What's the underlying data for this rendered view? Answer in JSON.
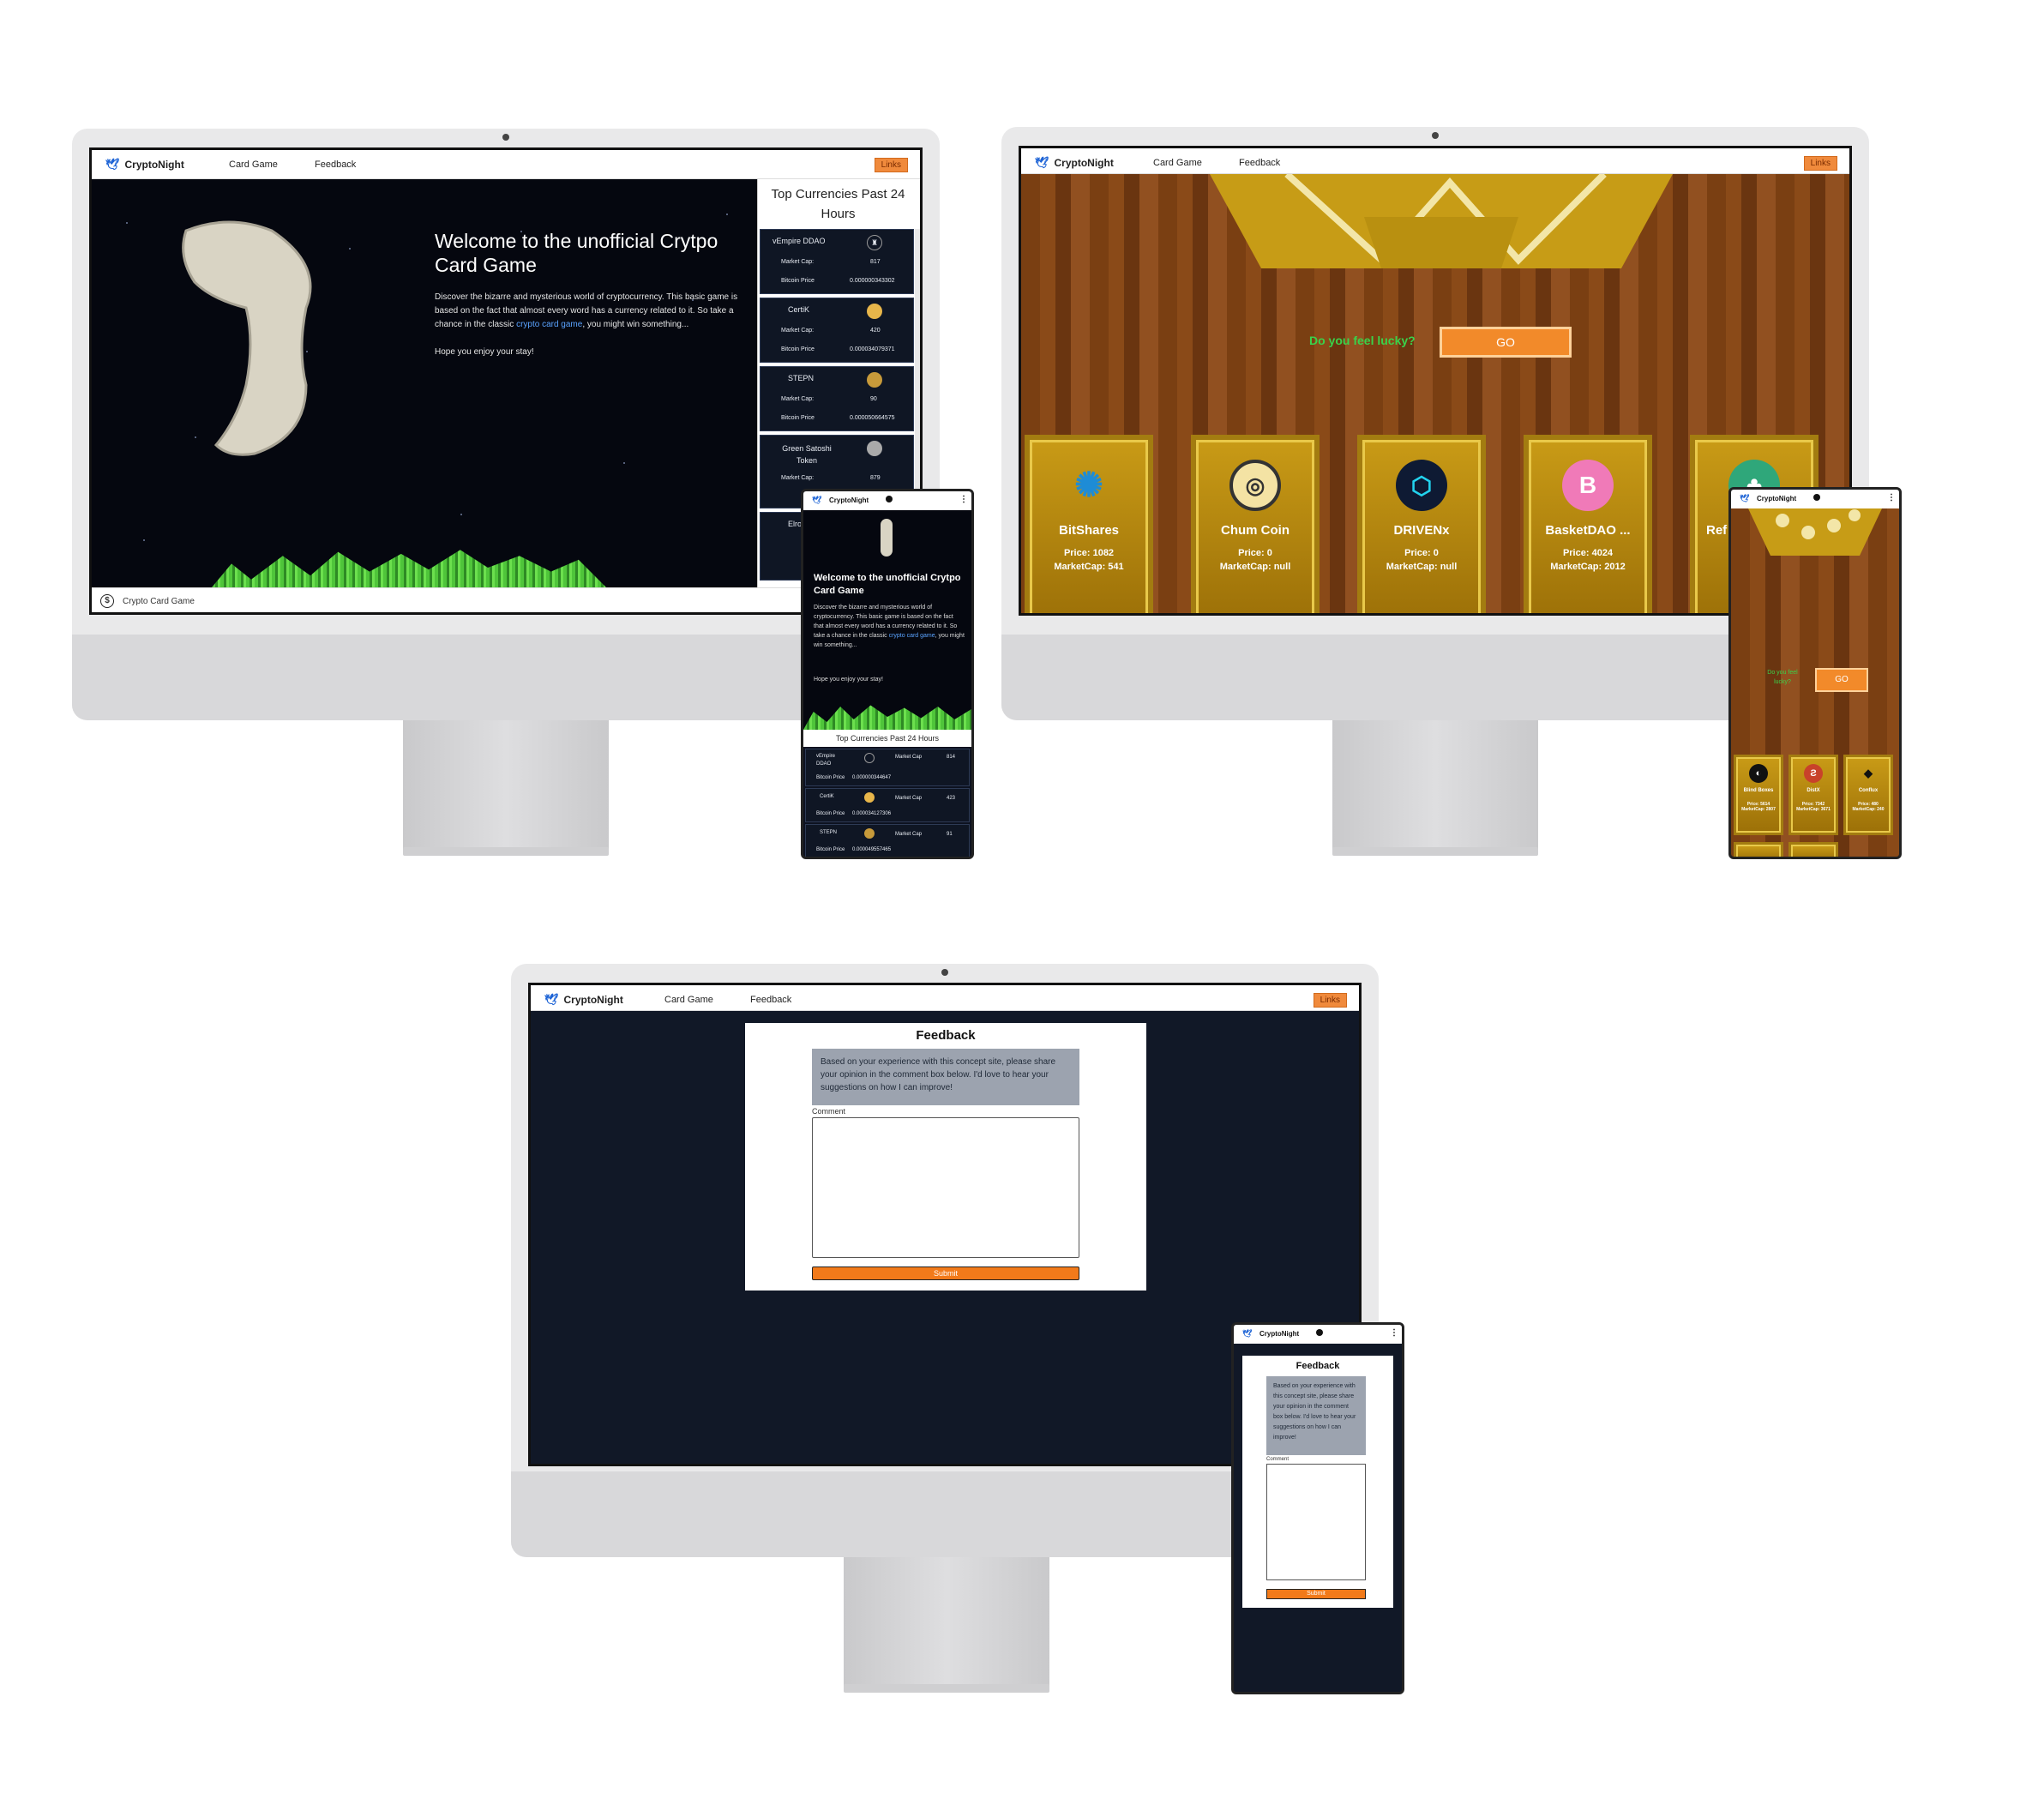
{
  "nav": {
    "brand": "CryptoNight",
    "card_game": "Card Game",
    "feedback": "Feedback",
    "links": "Links"
  },
  "home": {
    "title": "Welcome to the unofficial Crytpo Card Game",
    "para1_a": "Discover the bizarre and mysterious world of cryptocurrency. This basic game is based on the fact that almost every word has a currency related to it. So take a chance in the classic ",
    "para1_link": "crypto card game",
    "para1_b": ", you might win something...",
    "para2": "Hope you enjoy your stay!",
    "sidebar_title": "Top Currencies Past 24 Hours",
    "footer": "Crypto Card Game",
    "market_cap_label": "Market Cap:",
    "btc_price_label": "Bitcoin Price",
    "currencies": [
      {
        "name": "vEmpire DDAO",
        "market_cap": "817",
        "btc_price": "0.000000343302"
      },
      {
        "name": "CertiK",
        "market_cap": "420",
        "btc_price": "0.000034079371"
      },
      {
        "name": "STEPN",
        "market_cap": "90",
        "btc_price": "0.000050664575"
      },
      {
        "name": "Green Satoshi Token",
        "market_cap": "879",
        "btc_price": ""
      },
      {
        "name": "Elron",
        "market_cap": "",
        "btc_price": ""
      }
    ]
  },
  "home_phone": {
    "title": "Welcome to the unofficial Crytpo Card Game",
    "para1_a": "Discover the bizarre and mysterious world of cryptocurrency. This basic game is based on the fact that almost every word has a currency related to it. So take a chance in the classic ",
    "para1_link": "crypto card game",
    "para1_b": ", you might win something...",
    "para2": "Hope you enjoy your stay!",
    "sidebar_title": "Top Currencies Past 24 Hours",
    "market_cap_label": "Market Cap",
    "btc_price_label": "Bitcoin Price",
    "currencies": [
      {
        "name": "vEmpire DDAO",
        "market_cap": "814",
        "btc_price": "0.000000344647"
      },
      {
        "name": "CertiK",
        "market_cap": "423",
        "btc_price": "0.000034127306"
      },
      {
        "name": "STEPN",
        "market_cap": "91",
        "btc_price": "0.000049557465"
      }
    ]
  },
  "game": {
    "prompt": "Do you feel lucky?",
    "go": "GO",
    "price_label": "Price:",
    "mcap_label": "MarketCap:",
    "cards": [
      {
        "name": "BitShares",
        "price": "1082",
        "market_cap": "541"
      },
      {
        "name": "Chum Coin",
        "price": "0",
        "market_cap": "null"
      },
      {
        "name": "DRIVENx",
        "price": "0",
        "market_cap": "null"
      },
      {
        "name": "BasketDAO ...",
        "price": "4024",
        "market_cap": "2012"
      },
      {
        "name": "Ref",
        "price": "",
        "market_cap": ""
      }
    ]
  },
  "game_phone": {
    "prompt": "Do you feel lucky?",
    "go": "GO",
    "cards": [
      {
        "name": "Blind Boxes",
        "price": "5614",
        "market_cap": "2807"
      },
      {
        "name": "DistX",
        "price": "7342",
        "market_cap": "3671"
      },
      {
        "name": "Conflux",
        "price": "480",
        "market_cap": "240"
      }
    ]
  },
  "feedback": {
    "title": "Feedback",
    "info": "Based on your experience with this concept site, please share your opinion in the comment box below. I'd love to hear your suggestions on how I can improve!",
    "comment_label": "Comment",
    "submit": "Submit"
  },
  "colors": {
    "accent": "#f27a1a",
    "dark_bg": "#111827",
    "gold": "#c89a16",
    "brand_blue": "#1e64d6"
  }
}
